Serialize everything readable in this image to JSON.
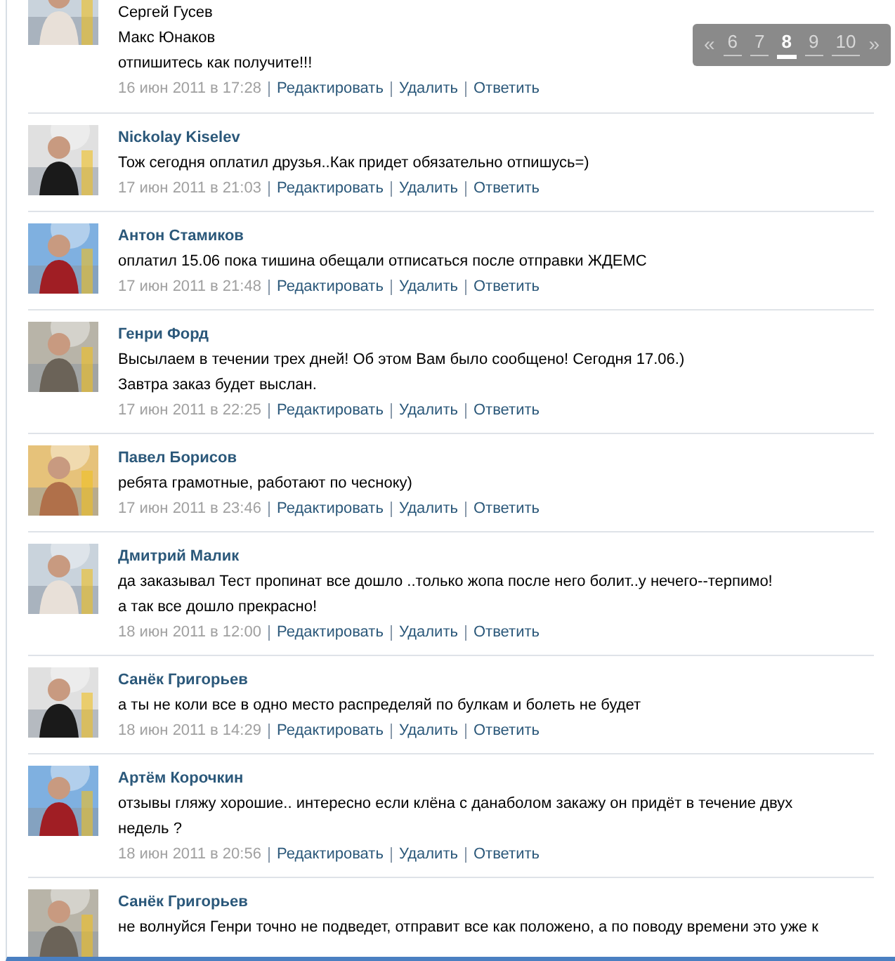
{
  "pager": {
    "prev": "«",
    "next": "»",
    "pages": [
      {
        "label": "6",
        "selected": false
      },
      {
        "label": "7",
        "selected": false
      },
      {
        "label": "8",
        "selected": true
      },
      {
        "label": "9",
        "selected": false
      },
      {
        "label": "10",
        "selected": false
      }
    ]
  },
  "comments": [
    {
      "lines": [
        "Сергей Гусев",
        "Макс Юнаков",
        "отпишитесь как получите!!!"
      ],
      "date": "16 июн 2011 в 17:28",
      "actions": [
        "Редактировать",
        "Удалить",
        "Ответить"
      ]
    },
    {
      "author": "Nickolay Kiselev",
      "lines": [
        "Тож сегодня оплатил друзья..Как придет обязательно отпишусь=)"
      ],
      "date": "17 июн 2011 в 21:03",
      "actions": [
        "Редактировать",
        "Удалить",
        "Ответить"
      ]
    },
    {
      "author": "Антон Стамиков",
      "lines": [
        "оплатил 15.06 пока тишина обещали отписаться после отправки ЖДЕМС"
      ],
      "date": "17 июн 2011 в 21:48",
      "actions": [
        "Редактировать",
        "Удалить",
        "Ответить"
      ]
    },
    {
      "author": "Генри Форд",
      "lines": [
        "Высылаем в течении трех дней! Об этом Вам было сообщено! Сегодня 17.06.)",
        "Завтра заказ будет выслан."
      ],
      "date": "17 июн 2011 в 22:25",
      "actions": [
        "Редактировать",
        "Удалить",
        "Ответить"
      ]
    },
    {
      "author": "Павел Борисов",
      "lines": [
        "ребята грамотные, работают по чесноку)"
      ],
      "date": "17 июн 2011 в 23:46",
      "actions": [
        "Редактировать",
        "Удалить",
        "Ответить"
      ]
    },
    {
      "author": "Дмитрий Малик",
      "lines": [
        "да заказывал Тест пропинат все дошло ..только жопа после него болит..у нечего--терпимо!",
        "а так все дошло прекрасно!"
      ],
      "date": "18 июн 2011 в 12:00",
      "actions": [
        "Редактировать",
        "Удалить",
        "Ответить"
      ]
    },
    {
      "author": "Санёк Григорьев",
      "lines": [
        "а ты не коли все в одно место распределяй по булкам и болеть не будет"
      ],
      "date": "18 июн 2011 в 14:29",
      "actions": [
        "Редактировать",
        "Удалить",
        "Ответить"
      ]
    },
    {
      "author": "Артём Корочкин",
      "lines": [
        "отзывы гляжу хорошие.. интересно если клёна с данаболом закажу он придёт в течение двух",
        "недель ?"
      ],
      "date": "18 июн 2011 в 20:56",
      "actions": [
        "Редактировать",
        "Удалить",
        "Ответить"
      ]
    },
    {
      "author": "Санёк Григорьев",
      "lines": [
        "не волнуйся Генри точно не подведет, отправит все как положено, а по поводу времени это уже к"
      ]
    }
  ]
}
